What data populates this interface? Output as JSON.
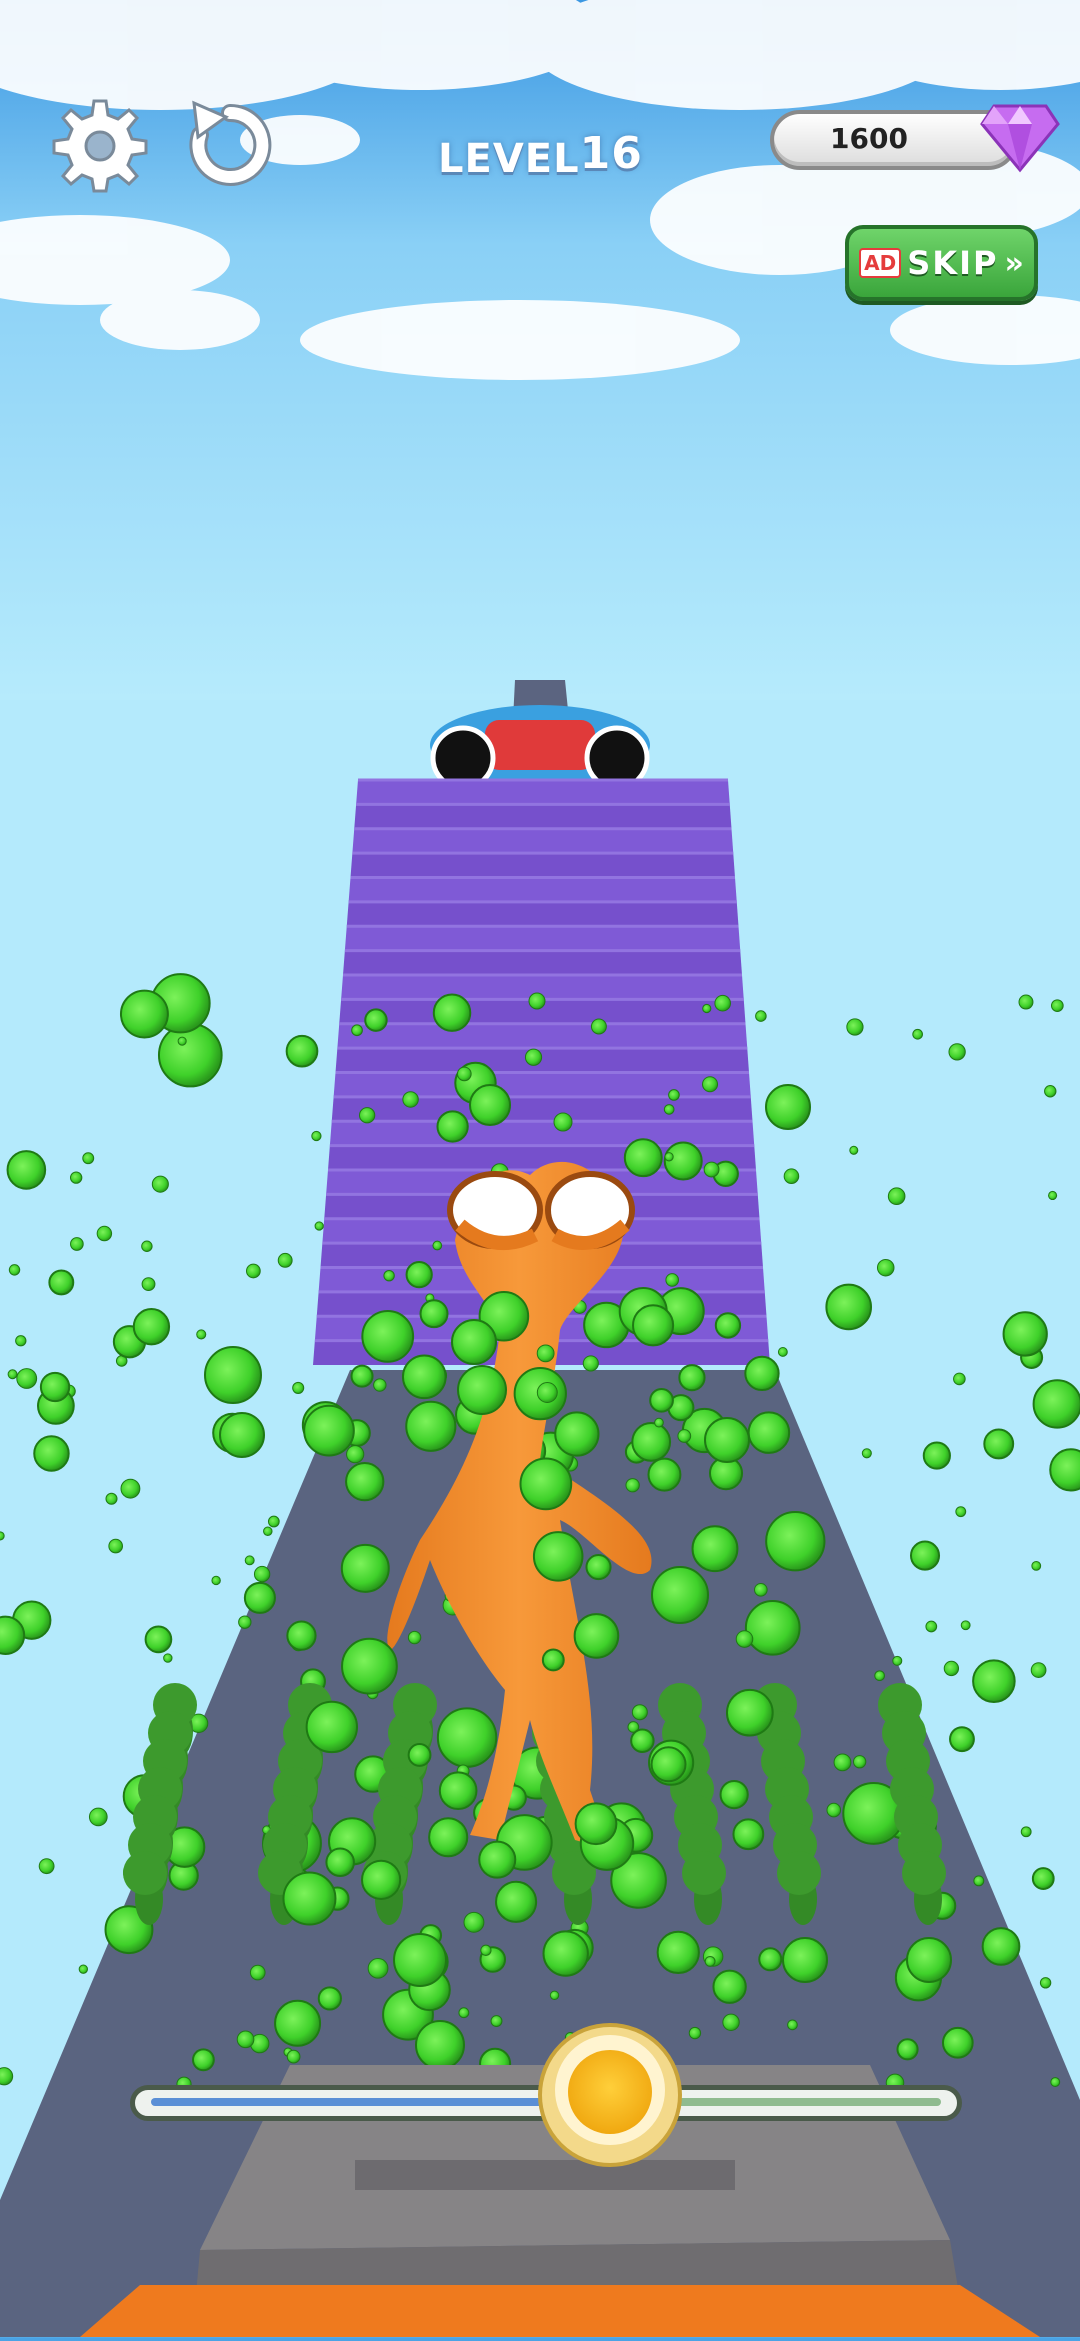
{
  "hud": {
    "level_label": "LEVEL",
    "level_number": "16",
    "gem_count": "1600",
    "skip_ad_label": "AD",
    "skip_label": "SKIP",
    "skip_chevron": "»"
  },
  "icons": {
    "settings": "gear-icon",
    "restart": "restart-icon",
    "currency": "diamond-icon"
  },
  "controls": {
    "slider_progress": 0.58
  },
  "colors": {
    "stairs": "#7b55d0",
    "runway": "#5a6480",
    "character": "#f08a2a",
    "crowd": "#3d9a2d",
    "goo": "#4ee030",
    "gem": "#c66cf0"
  }
}
